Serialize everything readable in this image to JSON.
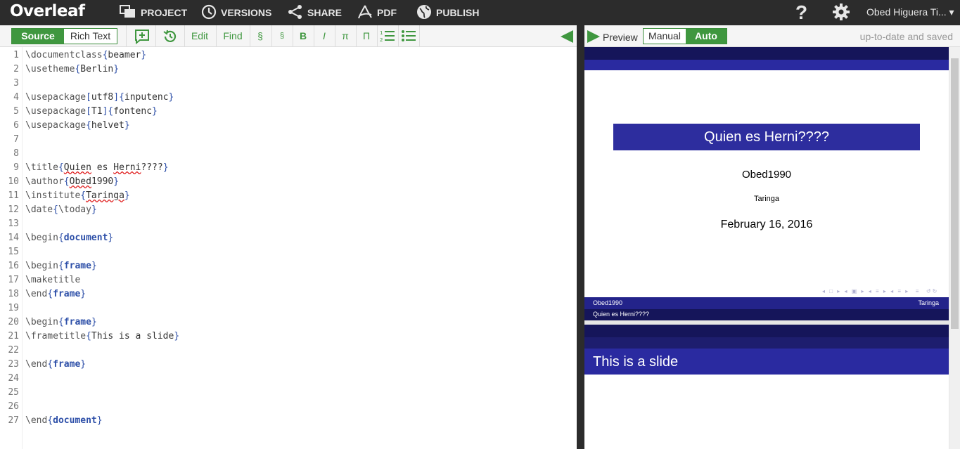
{
  "header": {
    "logo": "Overleaf",
    "nav": [
      {
        "label": "PROJECT",
        "icon": "project-icon"
      },
      {
        "label": "VERSIONS",
        "icon": "history-icon"
      },
      {
        "label": "SHARE",
        "icon": "share-icon"
      },
      {
        "label": "PDF",
        "icon": "pdf-icon"
      },
      {
        "label": "PUBLISH",
        "icon": "globe-icon"
      }
    ],
    "help": "?",
    "user": "Obed Higuera Ti... ▾"
  },
  "editor_toolbar": {
    "source": "Source",
    "rich_text": "Rich Text",
    "edit": "Edit",
    "find": "Find",
    "section": "§",
    "subsection": "§",
    "bold": "B",
    "italic": "I",
    "pi": "π",
    "capital_pi": "Π"
  },
  "preview_toolbar": {
    "preview": "Preview",
    "manual": "Manual",
    "auto": "Auto",
    "status": "up-to-date and saved"
  },
  "code_lines": [
    "\\documentclass{beamer}",
    "\\usetheme{Berlin}",
    "",
    "\\usepackage[utf8]{inputenc}",
    "\\usepackage[T1]{fontenc}",
    "\\usepackage{helvet}",
    "",
    "",
    "\\title{Quien es Herni????}",
    "\\author{Obed1990}",
    "\\institute{Taringa}",
    "\\date{\\today}",
    "",
    "\\begin{document}",
    "",
    "\\begin{frame}",
    "\\maketitle",
    "\\end{frame}",
    "",
    "\\begin{frame}",
    "\\frametitle{This is a slide}",
    "",
    "\\end{frame}",
    "",
    "",
    "",
    "\\end{document}"
  ],
  "slide1": {
    "title": "Quien es Herni????",
    "author": "Obed1990",
    "institute": "Taringa",
    "date": "February 16, 2016",
    "footer_left": "Obed1990",
    "footer_right": "Taringa",
    "footer_title": "Quien es Herni????"
  },
  "slide2": {
    "frametitle": "This is a slide"
  },
  "colors": {
    "topbar": "#2c2c2c",
    "accent_green": "#3f973f",
    "beamer_dark": "#15155a",
    "beamer_mid": "#2a2aa0"
  }
}
